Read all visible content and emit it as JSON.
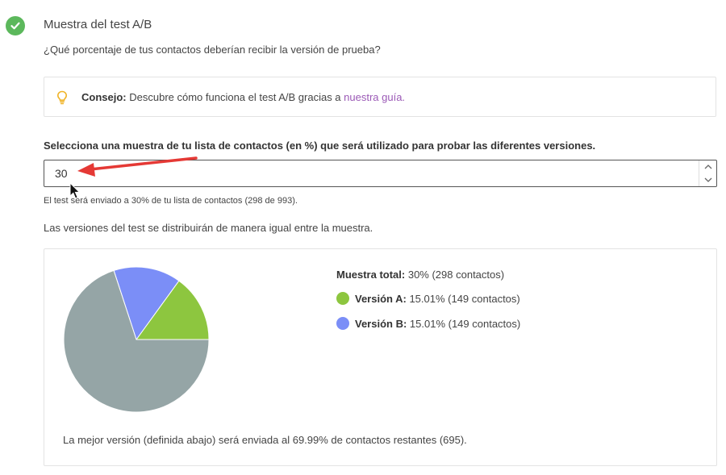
{
  "section": {
    "title": "Muestra del test A/B",
    "question": "¿Qué porcentaje de tus contactos deberían recibir la versión de prueba?"
  },
  "tip": {
    "label": "Consejo:",
    "text": " Descubre cómo funciona el test A/B gracias a ",
    "link": "nuestra guía."
  },
  "sample": {
    "label": "Selecciona una muestra de tu lista de contactos (en %) que será utilizado para probar las diferentes versiones.",
    "value": "30",
    "help": "El test será enviado a 30% de tu lista de contactos (298 de 993)."
  },
  "distribution_text": "Las versiones del test se distribuirán de manera igual entre la muestra.",
  "legend": {
    "total_label": "Muestra total:",
    "total_value": " 30% (298 contactos)",
    "version_a_label": "Versión A:",
    "version_a_value": " 15.01% (149 contactos)",
    "version_b_label": "Versión B:",
    "version_b_value": " 15.01% (149 contactos)"
  },
  "best_text": "La mejor versión (definida abajo) será enviada al 69.99% de contactos restantes (695).",
  "chart_data": {
    "type": "pie",
    "slices": [
      {
        "name": "Versión A",
        "value": 15.01,
        "color": "#8dc63f"
      },
      {
        "name": "Versión B",
        "value": 15.01,
        "color": "#7b8ef7"
      },
      {
        "name": "",
        "value": 69.98,
        "color": "#95a5a6"
      }
    ]
  },
  "colors": {
    "success": "#5cb85c",
    "link": "#9b59b6",
    "annotation": "#e53935",
    "tip_icon": "#f0b429"
  },
  "icons": {
    "status": "check-circle-icon",
    "tip": "lightbulb-icon",
    "spin_up": "chevron-up-icon",
    "spin_down": "chevron-down-icon",
    "cursor": "mouse-pointer-icon"
  }
}
